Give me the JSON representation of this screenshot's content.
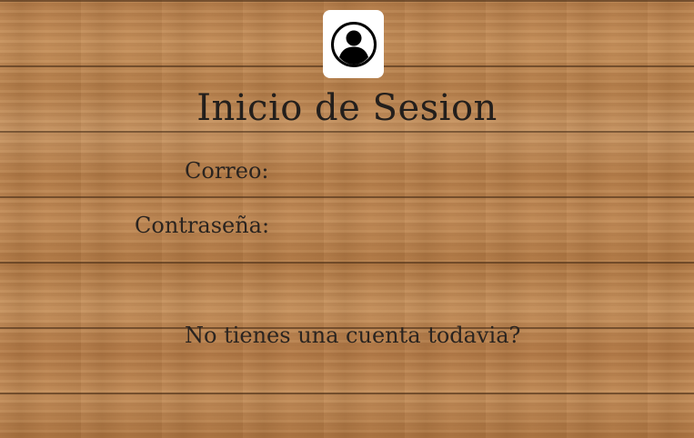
{
  "login": {
    "title": "Inicio de Sesion",
    "avatar_icon": "user-circle-icon",
    "email_label": "Correo:",
    "email_value": "",
    "password_label": "Contraseña:",
    "password_value": "",
    "signup_link": "No tienes una cuenta todavia?"
  },
  "colors": {
    "text": "#2a2420",
    "avatar_bg": "#ffffff",
    "avatar_icon": "#000000",
    "background": "#b9834f"
  }
}
